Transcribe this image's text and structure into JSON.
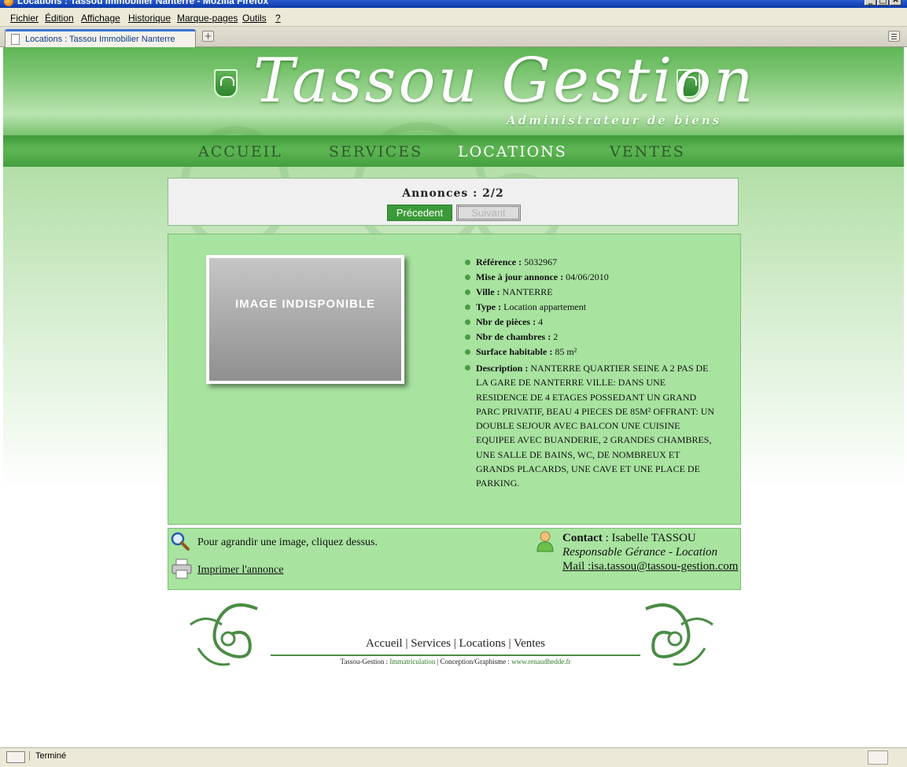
{
  "window": {
    "title": "Locations : Tassou Immobilier Nanterre - Mozilla Firefox"
  },
  "menu": [
    {
      "label": "Fichier"
    },
    {
      "label": "Édition"
    },
    {
      "label": "Affichage"
    },
    {
      "label": "Historique"
    },
    {
      "label": "Marque-pages"
    },
    {
      "label": "Outils"
    },
    {
      "label": "?"
    }
  ],
  "tabs": [
    {
      "label": "Locations : Tassou Immobilier Nanterre",
      "active": true
    }
  ],
  "site": {
    "brand": "Tassou Gestion",
    "tagline": "Administrateur de biens",
    "nav": [
      {
        "label": "ACCUEIL"
      },
      {
        "label": "SERVICES"
      },
      {
        "label": "LOCATIONS",
        "active": true
      },
      {
        "label": "VENTES"
      }
    ],
    "accent_color": "#3b9b38"
  },
  "annonces": {
    "title": "Annonces : 2/2",
    "prev_label": "Précedent",
    "next_label": "Suivant"
  },
  "listing": {
    "photo_placeholder": "IMAGE INDISPONIBLE",
    "details": [
      {
        "label": "Référence :",
        "value": "5032967"
      },
      {
        "label": "Mise à jour annonce :",
        "value": "04/06/2010"
      },
      {
        "label": "Ville :",
        "value": "NANTERRE"
      },
      {
        "label": "Type :",
        "value": "Location appartement"
      },
      {
        "label": "Nbr de pièces :",
        "value": "4"
      },
      {
        "label": "Nbr de chambres :",
        "value": "2"
      },
      {
        "label": "Surface habitable :",
        "value": "85 m²"
      },
      {
        "label": "Description :",
        "value": "NANTERRE QUARTIER SEINE A 2 PAS DE LA GARE DE NANTERRE VILLE: DANS UNE RESIDENCE DE 4 ETAGES POSSEDANT UN GRAND PARC PRIVATIF, BEAU 4 PIECES DE 85M² OFFRANT: UN DOUBLE SEJOUR AVEC BALCON UNE CUISINE EQUIPEE AVEC BUANDERIE, 2 GRANDES CHAMBRES, UNE SALLE DE BAINS, WC, DE NOMBREUX ET GRANDS PLACARDS, UNE CAVE ET UNE PLACE DE PARKING."
      }
    ]
  },
  "contact": {
    "hint": "Pour agrandir une image, cliquez dessus.",
    "print_label": "Imprimer l'annonce",
    "contact_label": "Contact",
    "contact_name": ": Isabelle TASSOU",
    "role": "Responsable Gérance - Location",
    "mail": "Mail :isa.tassou@tassou-gestion.com"
  },
  "footer": {
    "nav": [
      {
        "label": "Accueil"
      },
      {
        "label": "Services"
      },
      {
        "label": "Locations"
      },
      {
        "label": "Ventes"
      }
    ],
    "credits_prefix": "Tassou-Gestion :",
    "immat_label": "Immatriculation",
    "credits_mid": "| Conception/Graphisme :",
    "designer_link": "www.renaudhedde.fr"
  },
  "status": {
    "text": "Terminé"
  }
}
